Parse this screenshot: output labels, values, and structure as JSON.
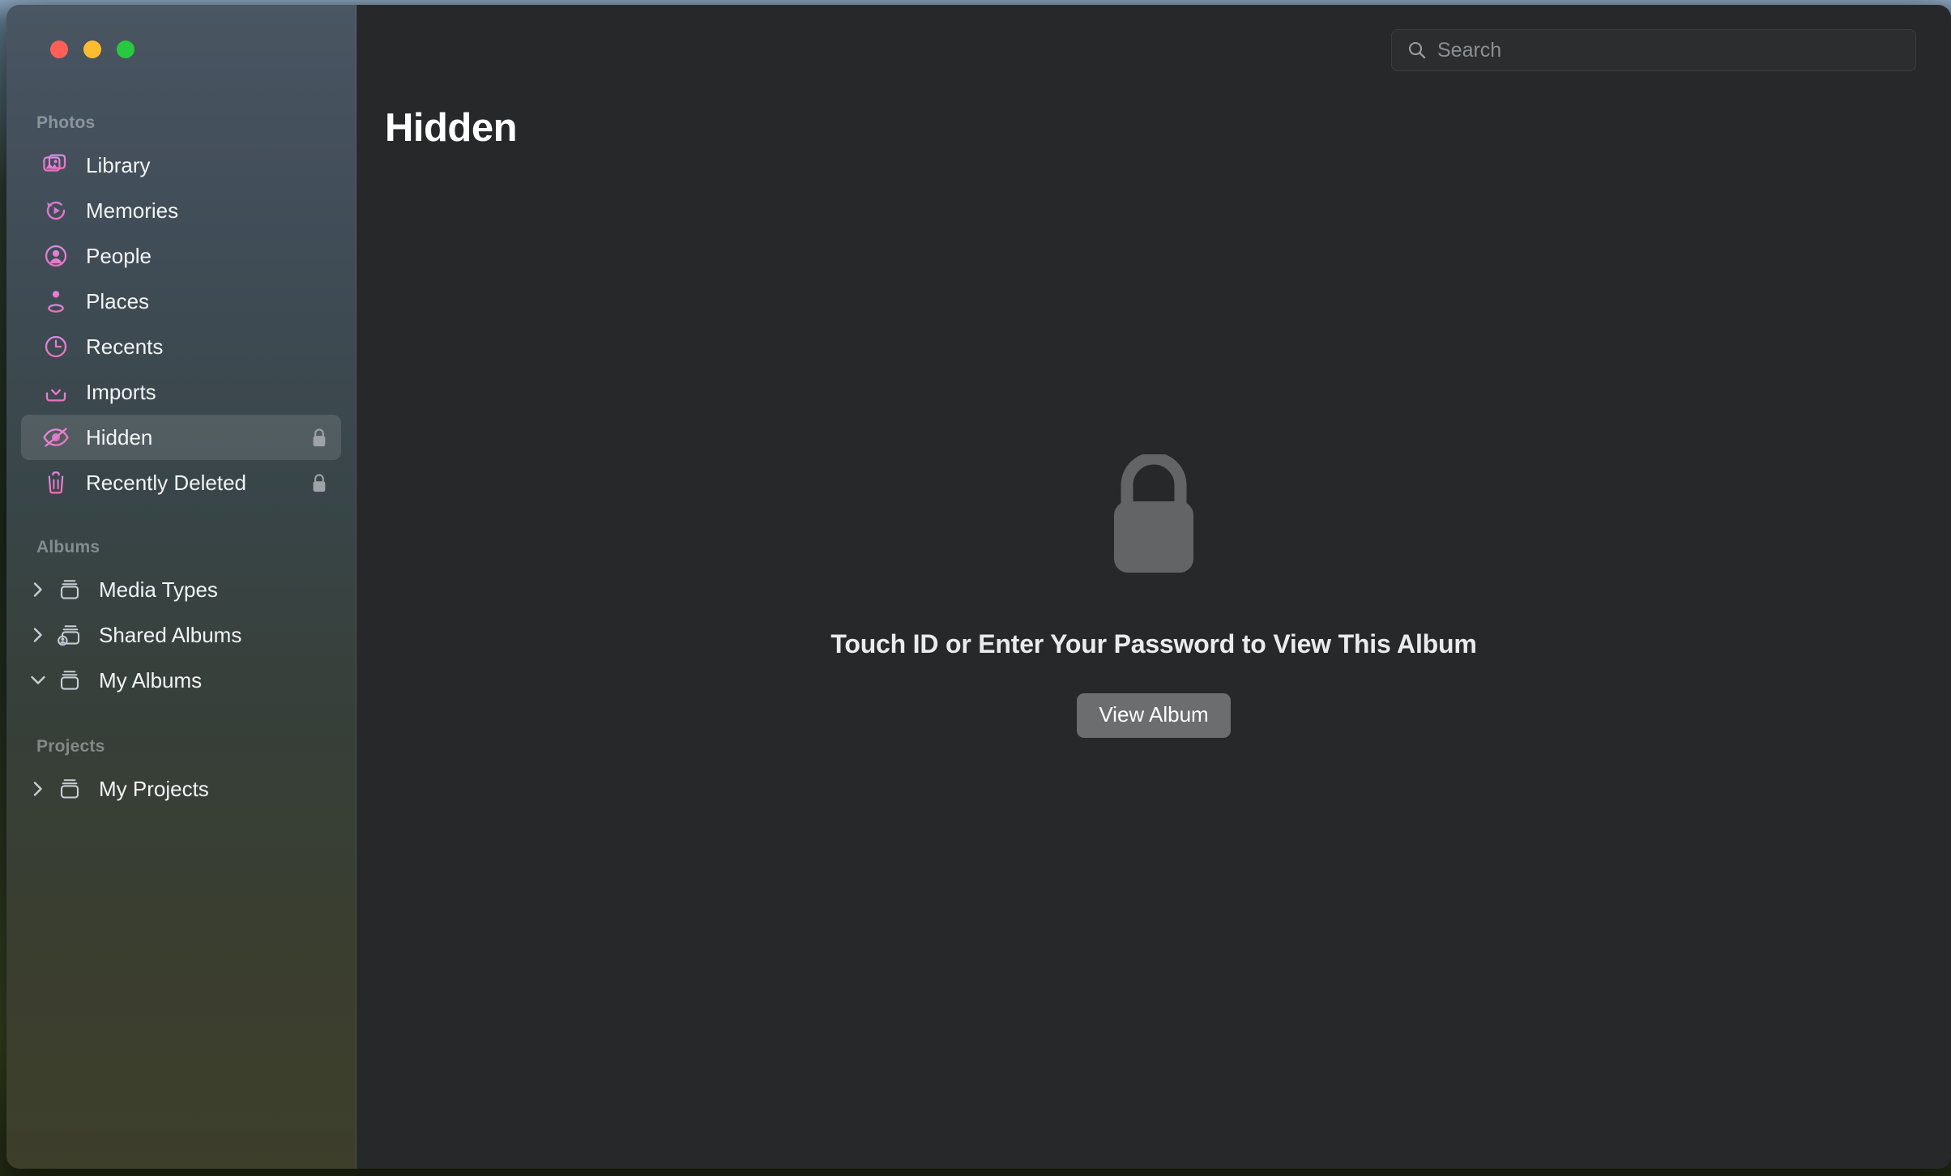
{
  "window": {
    "traffic_lights": [
      {
        "name": "close",
        "color": "#ff5f57"
      },
      {
        "name": "minimize",
        "color": "#febc2e"
      },
      {
        "name": "zoom",
        "color": "#28c840"
      }
    ]
  },
  "sidebar": {
    "sections": [
      {
        "title": "Photos",
        "items": [
          {
            "label": "Library",
            "icon": "photo-stack-icon",
            "accent": "#e87fd4",
            "selected": false,
            "locked": false
          },
          {
            "label": "Memories",
            "icon": "memories-play-icon",
            "accent": "#e87fd4",
            "selected": false,
            "locked": false
          },
          {
            "label": "People",
            "icon": "person-circle-icon",
            "accent": "#e87fd4",
            "selected": false,
            "locked": false
          },
          {
            "label": "Places",
            "icon": "map-pin-icon",
            "accent": "#e87fd4",
            "selected": false,
            "locked": false
          },
          {
            "label": "Recents",
            "icon": "clock-icon",
            "accent": "#e87fd4",
            "selected": false,
            "locked": false
          },
          {
            "label": "Imports",
            "icon": "import-tray-icon",
            "accent": "#e87fd4",
            "selected": false,
            "locked": false
          },
          {
            "label": "Hidden",
            "icon": "eye-slash-icon",
            "accent": "#e87fd4",
            "selected": true,
            "locked": true
          },
          {
            "label": "Recently Deleted",
            "icon": "trash-icon",
            "accent": "#e87fd4",
            "selected": false,
            "locked": true
          }
        ]
      },
      {
        "title": "Albums",
        "items": [
          {
            "label": "Media Types",
            "icon": "album-icon",
            "chevron": "right",
            "expanded": false
          },
          {
            "label": "Shared Albums",
            "icon": "shared-album-icon",
            "chevron": "right",
            "expanded": false
          },
          {
            "label": "My Albums",
            "icon": "album-icon",
            "chevron": "down",
            "expanded": true
          }
        ]
      },
      {
        "title": "Projects",
        "items": [
          {
            "label": "My Projects",
            "icon": "album-icon",
            "chevron": "right",
            "expanded": false
          }
        ]
      }
    ]
  },
  "search": {
    "placeholder": "Search",
    "value": "",
    "icon": "search-icon"
  },
  "main": {
    "title": "Hidden",
    "locked_state": {
      "icon": "padlock-closed-icon",
      "message": "Touch ID or Enter Your Password to View This Album",
      "button_label": "View Album"
    }
  },
  "colors": {
    "accent_pink": "#e87fd4",
    "main_bg": "#262829",
    "sidebar_top": "#485460",
    "sidebar_bottom": "#3e402c",
    "selected_row": "rgba(255,255,255,0.12)",
    "button_gray": "#6b6d6f"
  }
}
